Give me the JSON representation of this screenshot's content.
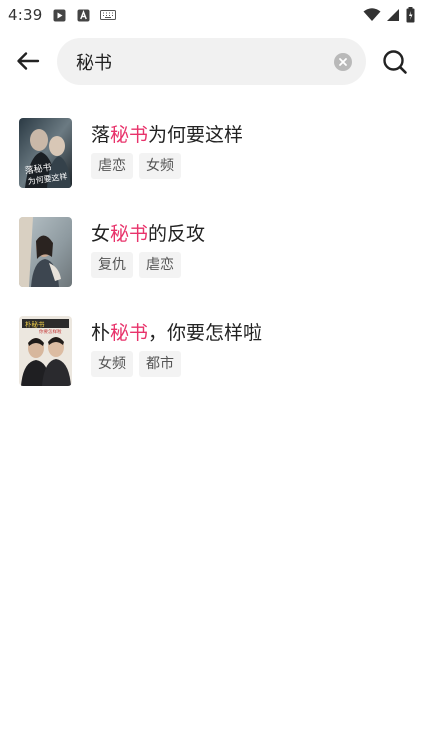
{
  "status_bar": {
    "time": "4:39"
  },
  "search": {
    "query": "秘书",
    "placeholder": ""
  },
  "results": [
    {
      "title_before": "落",
      "title_highlight": "秘书",
      "title_after": "为何要这样",
      "tags": [
        "虐恋",
        "女频"
      ],
      "cover_text": "落秘书为何要这样"
    },
    {
      "title_before": "女",
      "title_highlight": "秘书",
      "title_after": "的反攻",
      "tags": [
        "复仇",
        "虐恋"
      ]
    },
    {
      "title_before": "朴",
      "title_highlight": "秘书",
      "title_after": "，你要怎样啦",
      "tags": [
        "女频",
        "都市"
      ],
      "cover_text": "朴秘书你要怎样啦"
    }
  ],
  "colors": {
    "highlight": "#e8336b",
    "tag_bg": "#f3f3f3",
    "search_bg": "#f1f1f1"
  },
  "icons": {
    "back": "arrow-left-icon",
    "clear": "clear-circle-icon",
    "search": "search-icon"
  }
}
